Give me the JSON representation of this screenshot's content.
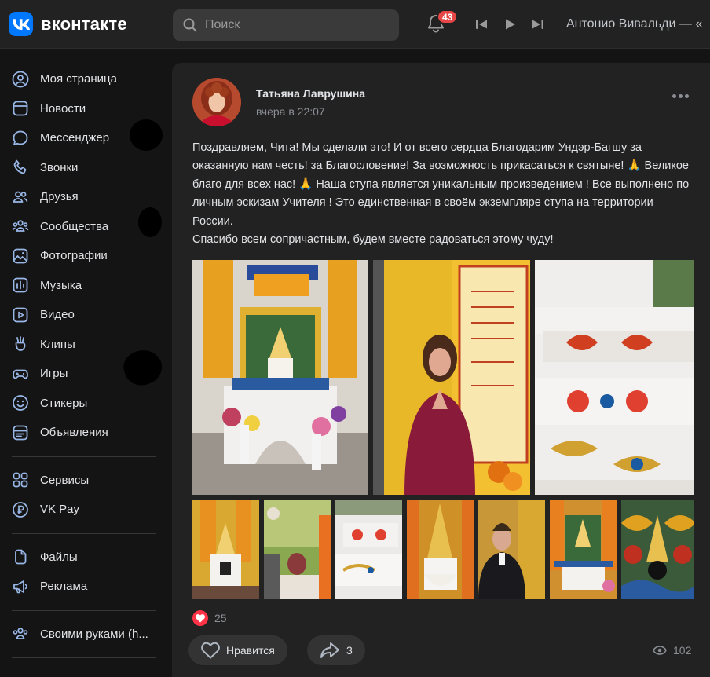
{
  "header": {
    "logo_text": "вконтакте",
    "search_placeholder": "Поиск",
    "notifications_count": "43",
    "now_playing": "Антонио Вивальди — «"
  },
  "sidebar": {
    "group1": [
      "Моя страница",
      "Новости",
      "Мессенджер",
      "Звонки",
      "Друзья",
      "Сообщества",
      "Фотографии",
      "Музыка",
      "Видео",
      "Клипы",
      "Игры",
      "Стикеры",
      "Объявления"
    ],
    "group2": [
      "Сервисы",
      "VK Pay"
    ],
    "group3": [
      "Файлы",
      "Реклама"
    ],
    "group4": [
      "Своими руками (h..."
    ]
  },
  "post": {
    "author": "Татьяна Лаврушина",
    "time": "вчера в 22:07",
    "text_lines": [
      "Поздравляем, Чита! Мы сделали это! И от всего сердца Благодарим Ундэр-Багшу за оказанную нам честь! за Благословение! За возможность прикасаться к святыне! 🙏 Великое благо для всех нас! 🙏 Наша ступа является уникальным произведением ! Все выполнено по личным эскизам Учителя ! Это единственная в своём экземпляре ступа на территории России.",
      "Спасибо всем сопричастным, будем вместе радоваться этому чуду!"
    ],
    "reactions_count": "25",
    "like_label": "Нравится",
    "share_count": "3",
    "views_count": "102"
  },
  "colors": {
    "accent": "#0077ff",
    "badge": "#e64646",
    "heart": "#ff3347"
  }
}
